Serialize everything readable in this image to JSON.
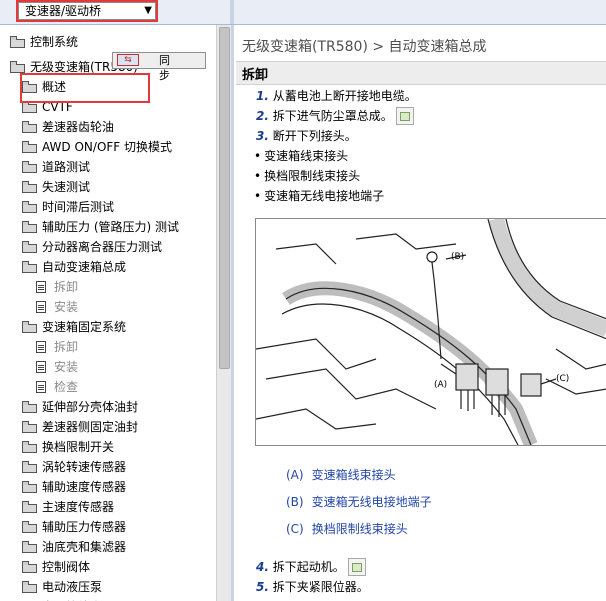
{
  "topbar": {
    "selector_value": "变速器/驱动桥",
    "selector_arrow": "▼"
  },
  "sync": {
    "label": "同 步"
  },
  "tree": [
    {
      "label": "控制系统",
      "kind": "folder",
      "level": 0
    },
    {
      "label": "无级变速箱(TR580)",
      "kind": "folder",
      "level": 0
    },
    {
      "label": "概述",
      "kind": "folder",
      "level": 1
    },
    {
      "label": "CVTF",
      "kind": "folder",
      "level": 1
    },
    {
      "label": "差速器齿轮油",
      "kind": "folder",
      "level": 1
    },
    {
      "label": "AWD ON/OFF 切换模式",
      "kind": "folder",
      "level": 1
    },
    {
      "label": "道路测试",
      "kind": "folder",
      "level": 1
    },
    {
      "label": "失速测试",
      "kind": "folder",
      "level": 1
    },
    {
      "label": "时间滞后测试",
      "kind": "folder",
      "level": 1
    },
    {
      "label": "辅助压力 (管路压力) 测试",
      "kind": "folder",
      "level": 1
    },
    {
      "label": "分动器离合器压力测试",
      "kind": "folder",
      "level": 1
    },
    {
      "label": "自动变速箱总成",
      "kind": "folder",
      "level": 1
    },
    {
      "label": "拆卸",
      "kind": "doc",
      "level": 2,
      "selected": true
    },
    {
      "label": "安装",
      "kind": "doc",
      "level": 2
    },
    {
      "label": "变速箱固定系统",
      "kind": "folder",
      "level": 1
    },
    {
      "label": "拆卸",
      "kind": "doc",
      "level": 2
    },
    {
      "label": "安装",
      "kind": "doc",
      "level": 2
    },
    {
      "label": "检查",
      "kind": "doc",
      "level": 2
    },
    {
      "label": "延伸部分壳体油封",
      "kind": "folder",
      "level": 1
    },
    {
      "label": "差速器侧固定油封",
      "kind": "folder",
      "level": 1
    },
    {
      "label": "换档限制开关",
      "kind": "folder",
      "level": 1
    },
    {
      "label": "涡轮转速传感器",
      "kind": "folder",
      "level": 1
    },
    {
      "label": "辅助速度传感器",
      "kind": "folder",
      "level": 1
    },
    {
      "label": "主速度传感器",
      "kind": "folder",
      "level": 1
    },
    {
      "label": "辅助压力传感器",
      "kind": "folder",
      "level": 1
    },
    {
      "label": "油底壳和集滤器",
      "kind": "folder",
      "level": 1
    },
    {
      "label": "控制阀体",
      "kind": "folder",
      "level": 1
    },
    {
      "label": "电动液压泵",
      "kind": "folder",
      "level": 1
    },
    {
      "label": "变速箱线束",
      "kind": "folder",
      "level": 1
    }
  ],
  "content": {
    "page_title": "无级变速箱(TR580) > 自动变速箱总成",
    "section_title": "拆卸",
    "steps_top": [
      {
        "num": "1.",
        "text": "从蓄电池上断开接地电缆。",
        "has_img": false
      },
      {
        "num": "2.",
        "text": "拆下进气防尘罩总成。",
        "has_img": true
      },
      {
        "num": "3.",
        "text": "断开下列接头。",
        "has_img": false
      }
    ],
    "bullets": [
      "变速箱线束接头",
      "换档限制线束接头",
      "变速箱无线电接地端子"
    ],
    "diagram_labels": {
      "a": "(A)",
      "b": "(B)",
      "c": "(C)"
    },
    "legend": [
      {
        "key": "(A)",
        "text": "变速箱线束接头"
      },
      {
        "key": "(B)",
        "text": "变速箱无线电接地端子"
      },
      {
        "key": "(C)",
        "text": "换档限制线束接头"
      }
    ],
    "steps_bottom": [
      {
        "num": "4.",
        "text": "拆下起动机。",
        "has_img": true
      },
      {
        "num": "5.",
        "text": "拆下夹紧限位器。",
        "has_img": false
      }
    ]
  }
}
